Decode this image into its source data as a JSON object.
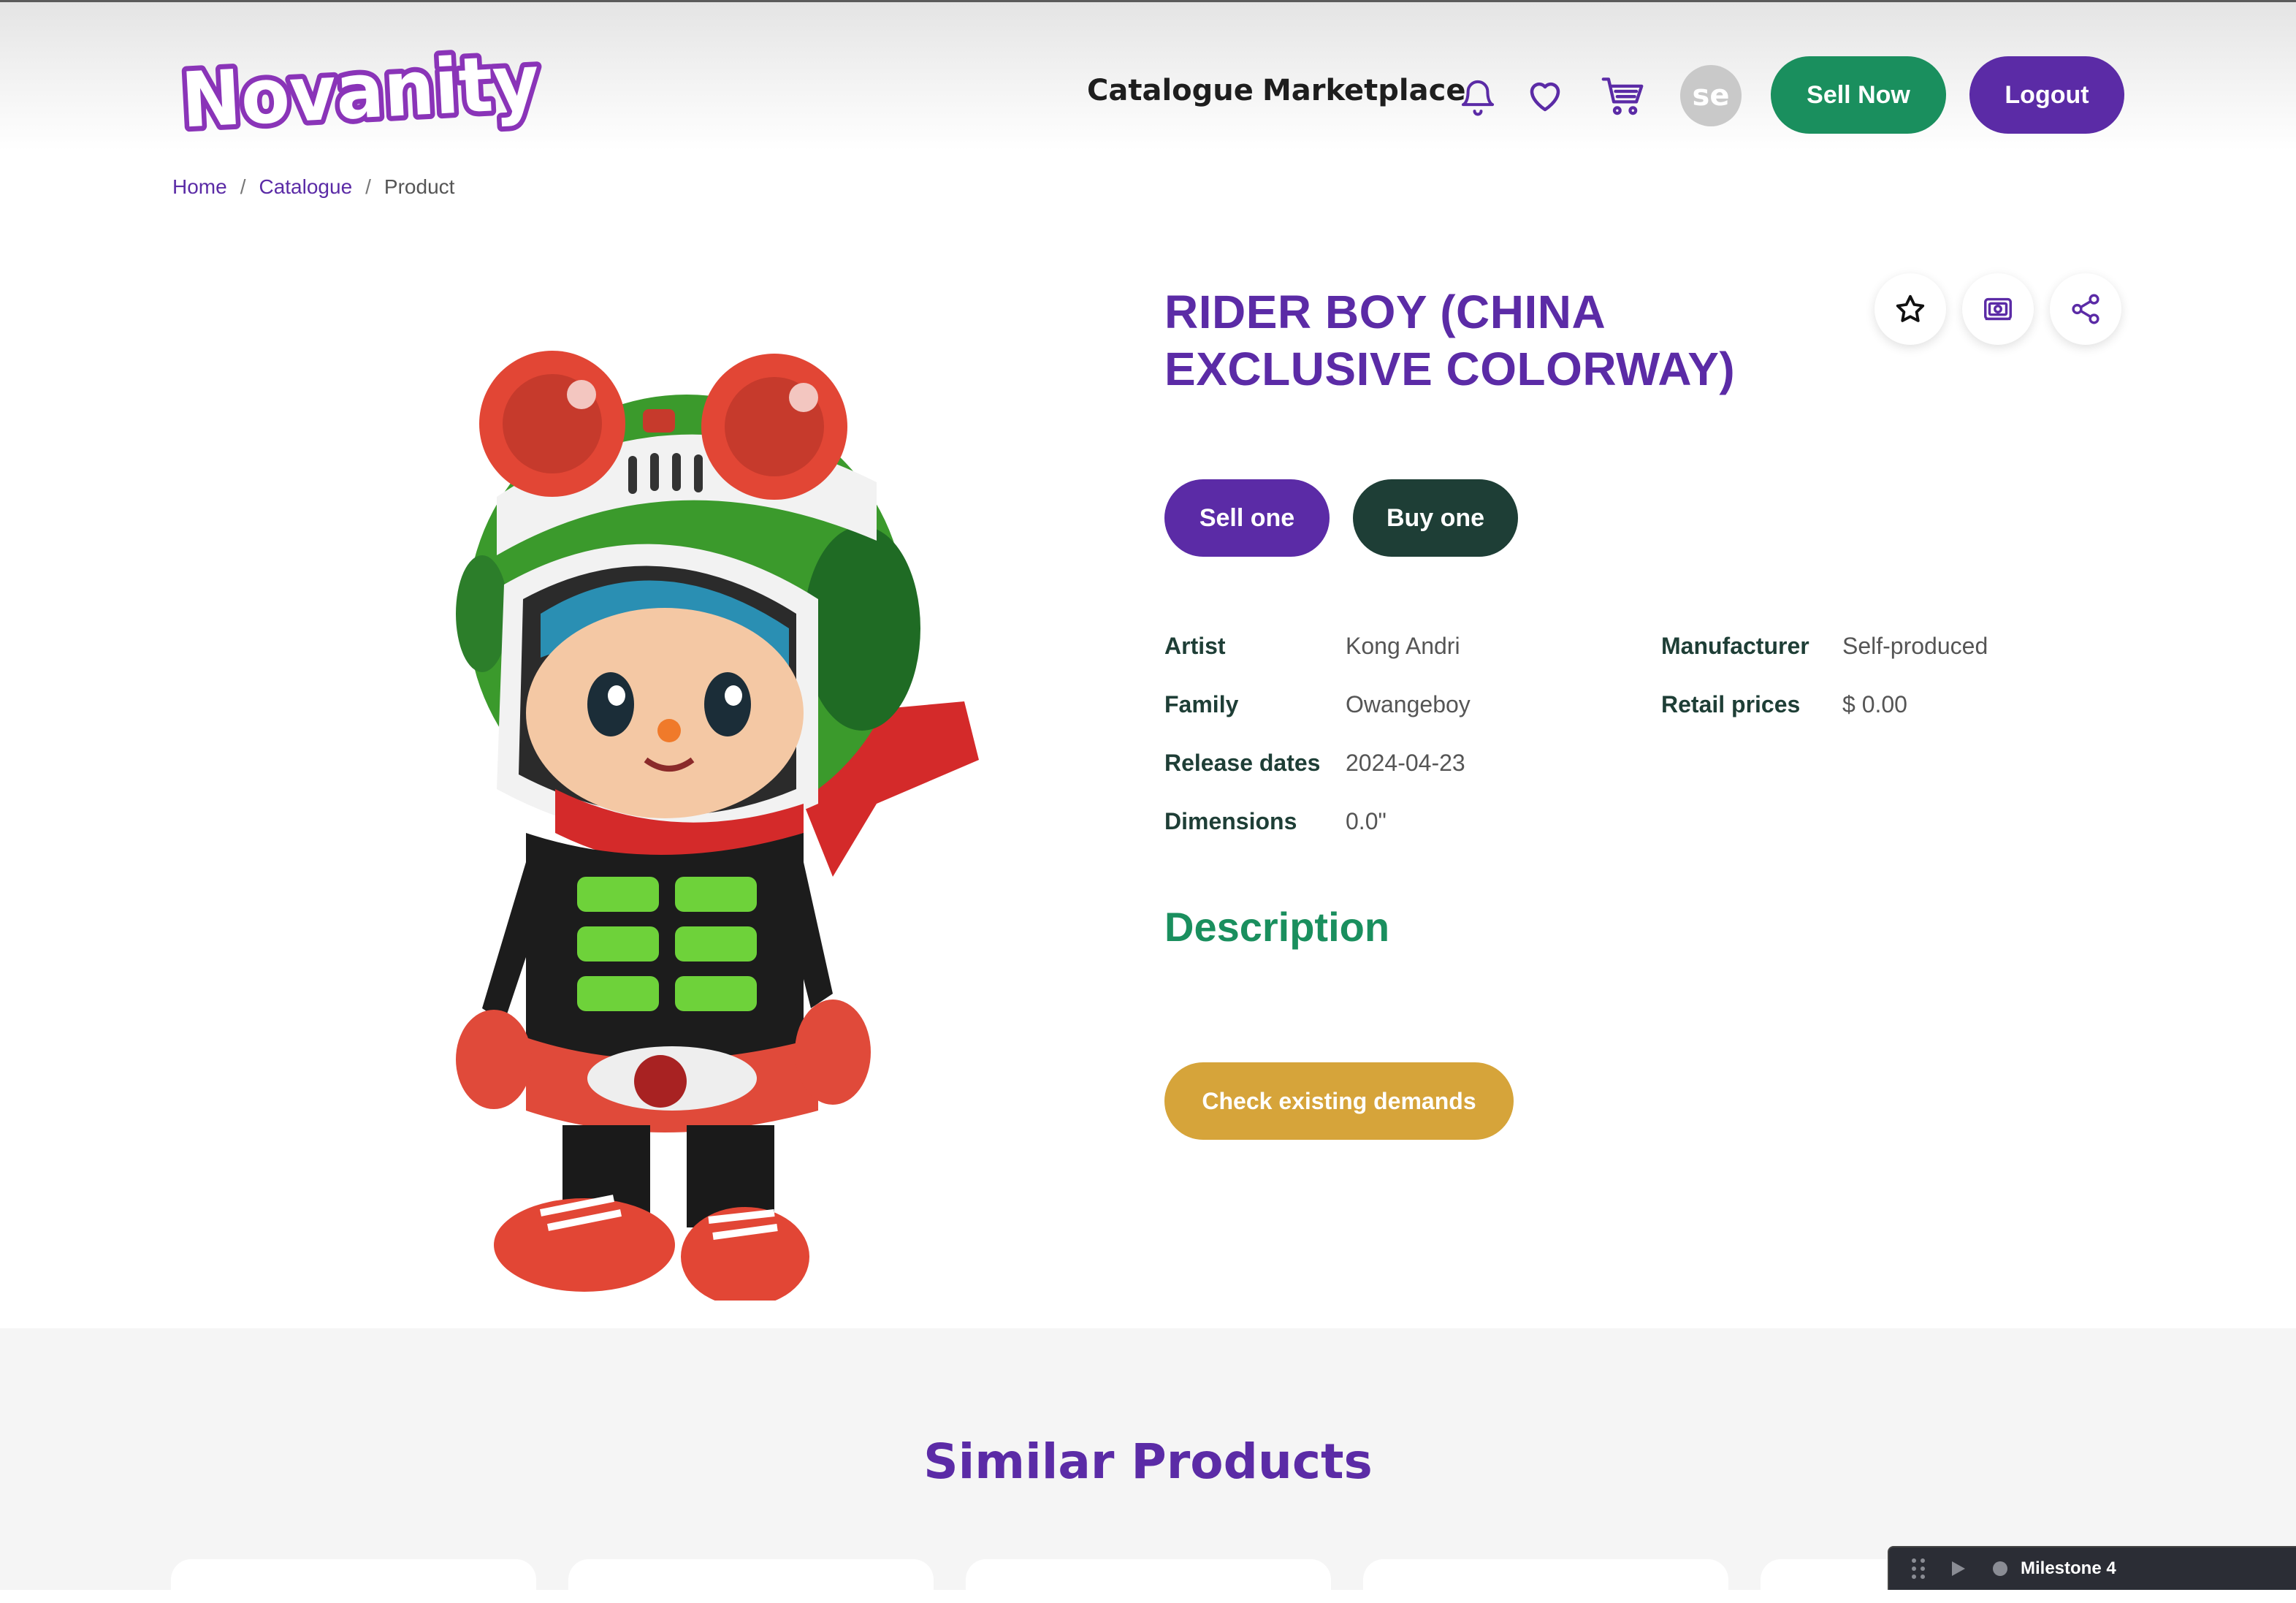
{
  "header": {
    "logo_text": "Novanity",
    "nav": {
      "catalogue": "Catalogue",
      "marketplace": "Marketplace"
    },
    "icons": [
      "bell-icon",
      "heart-icon",
      "cart-icon"
    ],
    "avatar_initials": "se",
    "sell_now": "Sell Now",
    "logout": "Logout"
  },
  "breadcrumb": {
    "home": "Home",
    "catalogue": "Catalogue",
    "current": "Product",
    "separator": "/"
  },
  "product": {
    "title": "RIDER BOY (CHINA EXCLUSIVE COLORWAY)",
    "action_icons": [
      "star-icon",
      "collection-icon",
      "share-icon"
    ],
    "sell_one": "Sell one",
    "buy_one": "Buy one",
    "details": {
      "artist_label": "Artist",
      "artist": "Kong Andri",
      "family_label": "Family",
      "family": "Owangeboy",
      "release_label": "Release dates",
      "release": "2024-04-23",
      "dimensions_label": "Dimensions",
      "dimensions": "0.0\"",
      "manufacturer_label": "Manufacturer",
      "manufacturer": "Self-produced",
      "retail_label": "Retail prices",
      "retail": "$ 0.00"
    },
    "description_heading": "Description",
    "check_demands": "Check existing demands"
  },
  "similar": {
    "title": "Similar Products"
  },
  "milestone": {
    "label": "Milestone 4"
  },
  "colors": {
    "brand_purple": "#5b2ba6",
    "brand_green": "#1a8f5e",
    "dark_green": "#1e3e36",
    "gold": "#d6a43a"
  }
}
